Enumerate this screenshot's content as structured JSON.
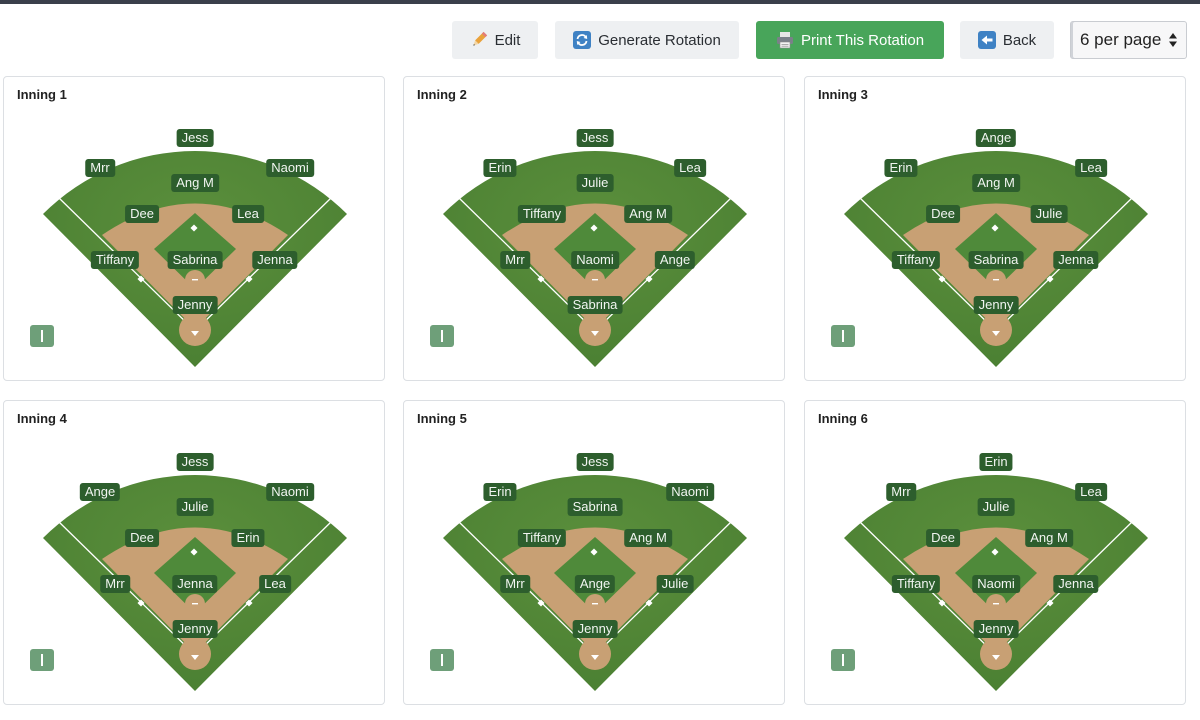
{
  "toolbar": {
    "edit_label": "Edit",
    "generate_label": "Generate Rotation",
    "print_label": "Print This Rotation",
    "back_label": "Back",
    "per_page_value": "6 per page",
    "edit_icon": "pencil-icon",
    "generate_icon": "refresh-icon",
    "print_icon": "printer-icon",
    "back_icon": "back-arrow-icon",
    "print_color": "#48a55a"
  },
  "colors": {
    "grass": "#4a7f32",
    "dirt": "#c8a074",
    "label_bg": "#2d5e2d",
    "collapse": "#6e9f79"
  },
  "innings": [
    {
      "title": "Inning 1",
      "positions": {
        "cf": "Jess",
        "lf": "Mrr",
        "rf": "Naomi",
        "rover": "Ang M",
        "ss": "Dee",
        "b2": "Lea",
        "b3": "Tiffany",
        "p": "Sabrina",
        "b1": "Jenna",
        "c": "Jenny"
      }
    },
    {
      "title": "Inning 2",
      "positions": {
        "cf": "Jess",
        "lf": "Erin",
        "rf": "Lea",
        "rover": "Julie",
        "ss": "Tiffany",
        "b2": "Ang M",
        "b3": "Mrr",
        "p": "Naomi",
        "b1": "Ange",
        "c": "Sabrina"
      }
    },
    {
      "title": "Inning 3",
      "positions": {
        "cf": "Ange",
        "lf": "Erin",
        "rf": "Lea",
        "rover": "Ang M",
        "ss": "Dee",
        "b2": "Julie",
        "b3": "Tiffany",
        "p": "Sabrina",
        "b1": "Jenna",
        "c": "Jenny"
      }
    },
    {
      "title": "Inning 4",
      "positions": {
        "cf": "Jess",
        "lf": "Ange",
        "rf": "Naomi",
        "rover": "Julie",
        "ss": "Dee",
        "b2": "Erin",
        "b3": "Mrr",
        "p": "Jenna",
        "b1": "Lea",
        "c": "Jenny"
      }
    },
    {
      "title": "Inning 5",
      "positions": {
        "cf": "Jess",
        "lf": "Erin",
        "rf": "Naomi",
        "rover": "Sabrina",
        "ss": "Tiffany",
        "b2": "Ang M",
        "b3": "Mrr",
        "p": "Ange",
        "b1": "Julie",
        "c": "Jenny"
      }
    },
    {
      "title": "Inning 6",
      "positions": {
        "cf": "Erin",
        "lf": "Mrr",
        "rf": "Lea",
        "rover": "Julie",
        "ss": "Dee",
        "b2": "Ang M",
        "b3": "Tiffany",
        "p": "Naomi",
        "b1": "Jenna",
        "c": "Jenny"
      }
    }
  ]
}
